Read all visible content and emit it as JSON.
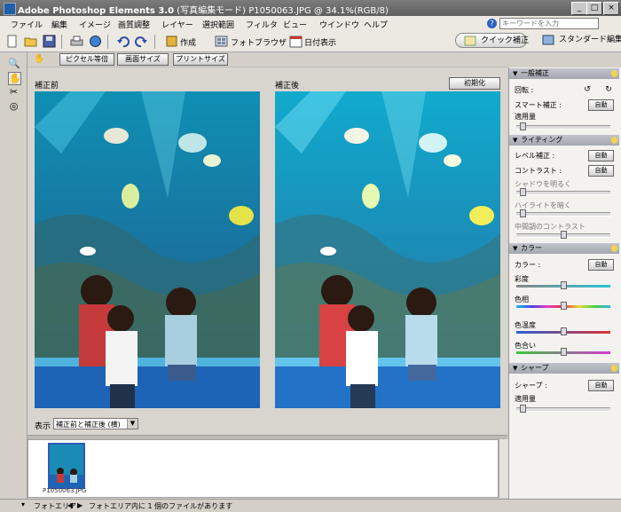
{
  "window": {
    "title_app": "Adobe Photoshop Elements 3.0",
    "title_mode": "(写真編集モード)",
    "title_file": "P1050063.JPG @ 34.1%(RGB/8)",
    "controls": [
      "_",
      "□",
      "×"
    ]
  },
  "menu": {
    "items": [
      "ファイル",
      "編集",
      "イメージ",
      "画質調整",
      "レイヤー",
      "選択範囲",
      "フィルタ",
      "ビュー",
      "ウインドウ",
      "ヘルプ"
    ],
    "search_placeholder": "キーワードを入力",
    "help_icon": "?"
  },
  "toolbar": {
    "create_label": "作成",
    "photo_browser_label": "フォトブラウザ",
    "date_view_label": "日付表示",
    "quick_fix_label": "クイック補正",
    "standard_edit_label": "スタンダード編集"
  },
  "subbar": {
    "actual_pixels": "ピクセル等倍",
    "fit_screen": "画面サイズ",
    "print_size": "プリントサイズ"
  },
  "canvas": {
    "before_label": "補正前",
    "after_label": "補正後",
    "reset_label": "初期化",
    "view_label": "表示 :",
    "view_value": "補正前と補正後 (横)"
  },
  "bin": {
    "thumbnail_name": "P1050063.JPG"
  },
  "status": {
    "area_label": "フォトエリア",
    "message": "フォトエリア内に 1 個のファイルがあります"
  },
  "panel": {
    "general": {
      "title": "一般補正",
      "rotate_label": "回転 :",
      "smart_fix_label": "スマート補正 :",
      "amount_label": "適用量",
      "auto_label": "自動",
      "amount_value": 0
    },
    "lighting": {
      "title": "ライティング",
      "levels_label": "レベル補正 :",
      "contrast_label": "コントラスト :",
      "shadows_label": "シャドウを明るく",
      "highlights_label": "ハイライトを暗く",
      "midtone_label": "中間調のコントラスト",
      "auto_label": "自動"
    },
    "color": {
      "title": "カラー",
      "color_label": "カラー :",
      "saturation_label": "彩度",
      "hue_label": "色相",
      "temperature_label": "色温度",
      "tint_label": "色合い",
      "auto_label": "自動"
    },
    "sharpen": {
      "title": "シャープ",
      "sharpen_label": "シャープ :",
      "amount_label": "適用量",
      "auto_label": "自動"
    }
  },
  "colors": {
    "titlebar": "#6b6b6b",
    "section_header": "#b3b6bf",
    "selection_border": "#2c5db4"
  }
}
